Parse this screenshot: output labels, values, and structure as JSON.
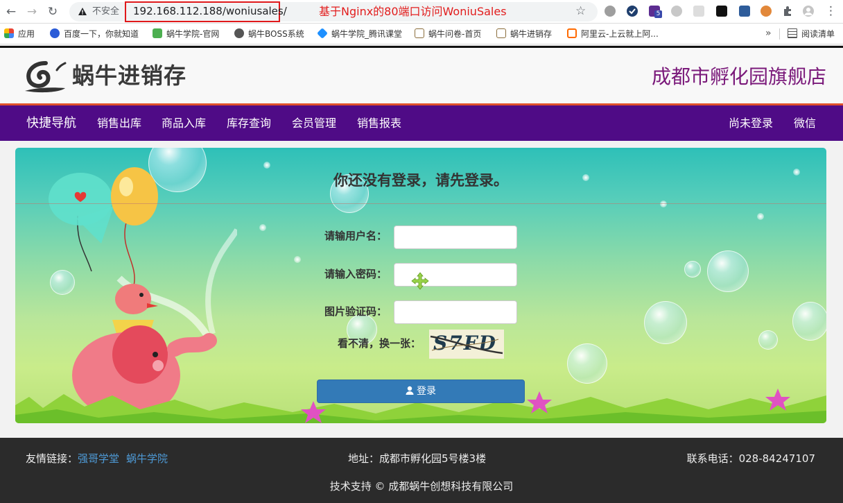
{
  "browser": {
    "back_glyph": "←",
    "forward_glyph": "→",
    "reload_glyph": "↻",
    "insecure_label": "不安全",
    "url": "192.168.112.188/woniusales/",
    "annotation": "基于Nginx的80端口访问WoniuSales",
    "star_glyph": "☆",
    "menu_glyph": "⋮",
    "extension_badge": "5",
    "bookmarks": [
      {
        "label": "应用",
        "icon": "apps-grid-icon",
        "color": "#e94335"
      },
      {
        "label": "百度一下，你就知道",
        "icon": "baidu-paw-icon",
        "color": "#2a5bd7"
      },
      {
        "label": "蜗牛学院-官网",
        "icon": "woniu-leaf-icon",
        "color": "#4caf50"
      },
      {
        "label": "蜗牛BOSS系统",
        "icon": "globe-icon",
        "color": "#555555"
      },
      {
        "label": "蜗牛学院_腾讯课堂",
        "icon": "tencent-class-icon",
        "color": "#1e90ff"
      },
      {
        "label": "蜗牛问卷-首页",
        "icon": "page-icon",
        "color": "#8a6d3b"
      },
      {
        "label": "蜗牛进销存",
        "icon": "page-icon",
        "color": "#8a6d3b"
      },
      {
        "label": "阿里云-上云就上阿...",
        "icon": "aliyun-icon",
        "color": "#ff6a00"
      }
    ],
    "bookmarks_more": "»",
    "reading_list": "阅读清单"
  },
  "site": {
    "logo_text": "蜗牛进销存",
    "store_name": "成都市孵化园旗舰店"
  },
  "nav": {
    "brand": "快捷导航",
    "items": [
      "销售出库",
      "商品入库",
      "库存查询",
      "会员管理",
      "销售报表"
    ],
    "login_status": "尚未登录",
    "wechat": "微信"
  },
  "login": {
    "title": "你还没有登录，请先登录。",
    "username_label": "请输用户名：",
    "password_label": "请输入密码：",
    "captcha_label": "图片验证码：",
    "refresh_label": "看不清，换一张：",
    "captcha_text": "S7FD",
    "submit_label": "登录"
  },
  "footer": {
    "friend_links_label": "友情链接：",
    "links": [
      "强哥学堂",
      "蜗牛学院"
    ],
    "address": "地址：成都市孵化园5号楼3楼",
    "phone": "联系电话：028-84247107",
    "copyright": "技术支持 © 成都蜗牛创想科技有限公司"
  },
  "colors": {
    "nav_bg": "#4f0b86",
    "nav_accent": "#e0512b",
    "store_name": "#7a197a",
    "button": "#337ab7",
    "footer_bg": "#2b2b2b",
    "link": "#4e9ad6",
    "annotation": "#e21d1d"
  }
}
